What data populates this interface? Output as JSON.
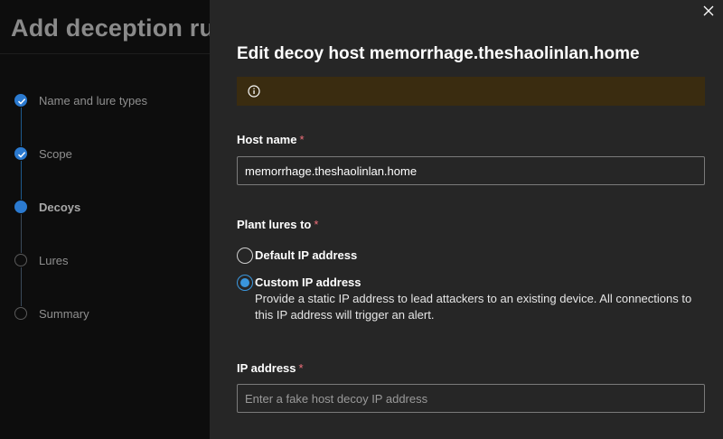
{
  "wizard": {
    "title": "Add deception ru",
    "steps": [
      {
        "label": "Name and lure types",
        "state": "done"
      },
      {
        "label": "Scope",
        "state": "done"
      },
      {
        "label": "Decoys",
        "state": "current"
      },
      {
        "label": "Lures",
        "state": "pending"
      },
      {
        "label": "Summary",
        "state": "pending"
      }
    ]
  },
  "panel": {
    "title": "Edit decoy host memorrhage.theshaolinlan.home",
    "close_icon": "close-icon",
    "info_icon": "info-icon",
    "host_name": {
      "label": "Host name",
      "required_mark": "*",
      "value": "memorrhage.theshaolinlan.home"
    },
    "plant_lures": {
      "label": "Plant lures to",
      "required_mark": "*",
      "options": [
        {
          "label": "Default IP address",
          "selected": false
        },
        {
          "label": "Custom IP address",
          "selected": true,
          "description": "Provide a static IP address to lead attackers to an existing device. All connections to this IP address will trigger an alert."
        }
      ]
    },
    "ip_address": {
      "label": "IP address",
      "required_mark": "*",
      "value": "",
      "placeholder": "Enter a fake host decoy IP address"
    }
  },
  "colors": {
    "accent": "#3a96dd",
    "step_done": "#2b7ad0",
    "required": "#f1707b",
    "info_bar": "#3a2c10",
    "panel_bg": "#262626"
  }
}
